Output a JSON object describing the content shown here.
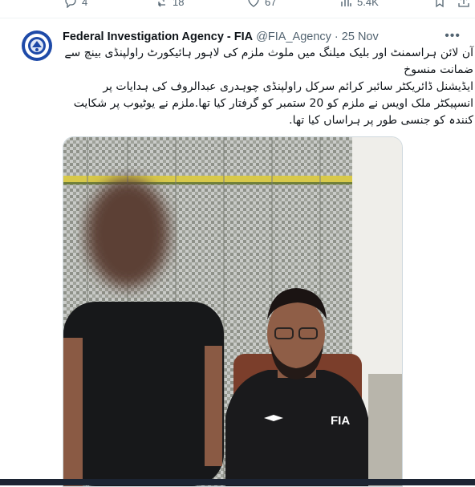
{
  "prev_actions": {
    "replies": "4",
    "reposts": "18",
    "likes": "67",
    "views": "5.4K"
  },
  "tweet": {
    "author_name": "Federal Investigation Agency - FIA",
    "handle": "@FIA_Agency",
    "separator": " · ",
    "date": "25 Nov",
    "more_label": "•••",
    "text_lines": [
      "آن لائن ہراسمنٹ اور بلیک میلنگ میں ملوث ملزم کی لاہور ہائیکورٹ راولپنڈی بینچ سے ضمانت منسوخ",
      "ایڈیشنل ڈائریکٹر سائبر کرائم سرکل راولپنڈی چوہدری عبدالروف کی ہدایات پر انسپیکٹر ملک اویس نے ملزم کو 20 ستمبر کو گرفتار کیا تھا.ملزم نے یوٹیوب پر شکایت کنندہ کو جنسی طور پر ہراساں کیا تھا."
    ],
    "shirt_text": "FIA"
  },
  "colors": {
    "text_primary": "#0f1419",
    "text_secondary": "#536471",
    "border": "#eff3f4",
    "taskbar": "#1c2433"
  },
  "icons": {
    "reply": "reply-icon",
    "repost": "repost-icon",
    "like": "like-icon",
    "views": "views-icon",
    "bookmark": "bookmark-icon",
    "share": "share-icon"
  }
}
